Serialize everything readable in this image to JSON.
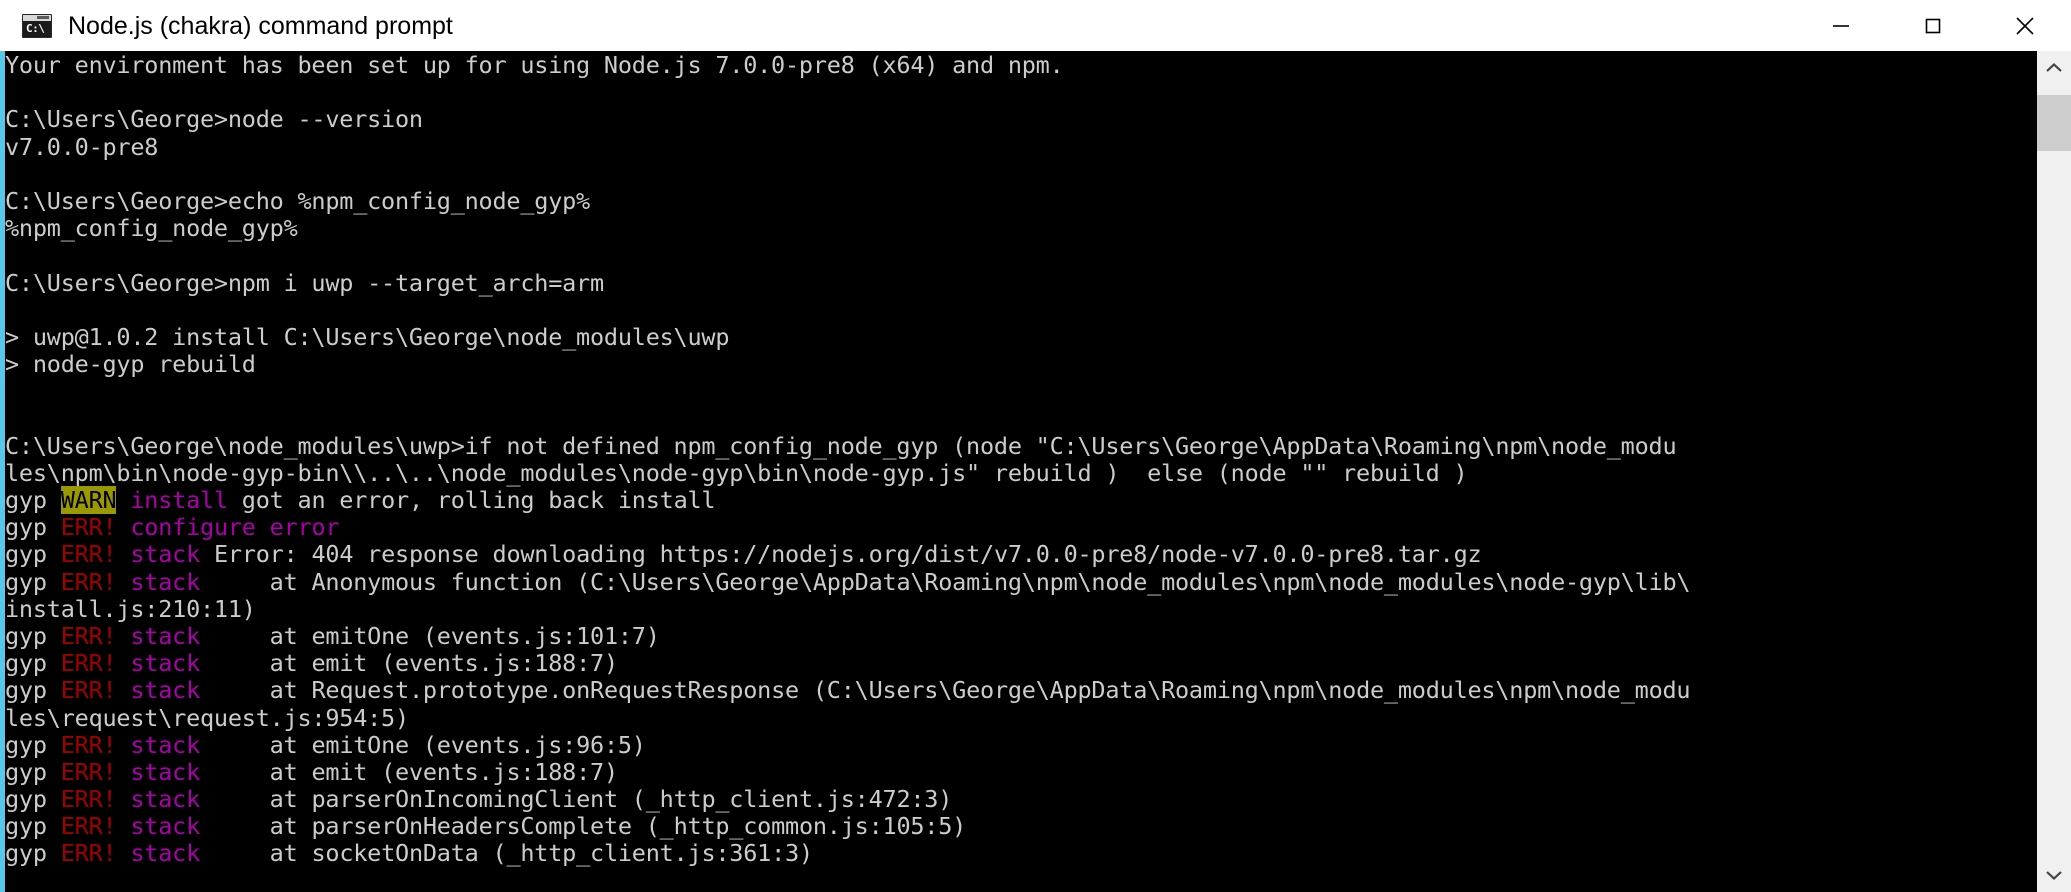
{
  "window": {
    "title": "Node.js (chakra) command prompt",
    "icon": "console-icon",
    "icon_prompt_text": "C:\\",
    "accent_edge_color": "#57c8ec",
    "background_color": "#000000",
    "foreground_color": "#cccccc"
  },
  "window_controls": {
    "minimize_label": "Minimize",
    "maximize_label": "Maximize",
    "close_label": "Close"
  },
  "scrollbar": {
    "up_arrow_label": "Scroll up",
    "down_arrow_label": "Scroll down",
    "thumb_label": "Scroll thumb"
  },
  "console": {
    "lines": [
      [
        {
          "t": "Your environment has been set up for using Node.js 7.0.0-pre8 (x64) and npm.",
          "c": "default"
        }
      ],
      [
        {
          "t": "",
          "c": "default"
        }
      ],
      [
        {
          "t": "C:\\Users\\George>node --version",
          "c": "default"
        }
      ],
      [
        {
          "t": "v7.0.0-pre8",
          "c": "default"
        }
      ],
      [
        {
          "t": "",
          "c": "default"
        }
      ],
      [
        {
          "t": "C:\\Users\\George>echo %npm_config_node_gyp%",
          "c": "default"
        }
      ],
      [
        {
          "t": "%npm_config_node_gyp%",
          "c": "default"
        }
      ],
      [
        {
          "t": "",
          "c": "default"
        }
      ],
      [
        {
          "t": "C:\\Users\\George>npm i uwp --target_arch=arm",
          "c": "default"
        }
      ],
      [
        {
          "t": "",
          "c": "default"
        }
      ],
      [
        {
          "t": "> uwp@1.0.2 install C:\\Users\\George\\node_modules\\uwp",
          "c": "default"
        }
      ],
      [
        {
          "t": "> node-gyp rebuild",
          "c": "default"
        }
      ],
      [
        {
          "t": "",
          "c": "default"
        }
      ],
      [
        {
          "t": "",
          "c": "default"
        }
      ],
      [
        {
          "t": "C:\\Users\\George\\node_modules\\uwp>if not defined npm_config_node_gyp (node \"C:\\Users\\George\\AppData\\Roaming\\npm\\node_modu",
          "c": "default"
        }
      ],
      [
        {
          "t": "les\\npm\\bin\\node-gyp-bin\\\\..\\..\\node_modules\\node-gyp\\bin\\node-gyp.js\" rebuild )  else (node \"\" rebuild )",
          "c": "default"
        }
      ],
      [
        {
          "t": "gyp ",
          "c": "white"
        },
        {
          "t": "WARN",
          "c": "warn"
        },
        {
          "t": " ",
          "c": "white"
        },
        {
          "t": "install",
          "c": "magenta"
        },
        {
          "t": " got an error, rolling back install",
          "c": "white"
        }
      ],
      [
        {
          "t": "gyp ",
          "c": "white"
        },
        {
          "t": "ERR!",
          "c": "red"
        },
        {
          "t": " ",
          "c": "white"
        },
        {
          "t": "configure error",
          "c": "magenta"
        }
      ],
      [
        {
          "t": "gyp ",
          "c": "white"
        },
        {
          "t": "ERR!",
          "c": "red"
        },
        {
          "t": " ",
          "c": "white"
        },
        {
          "t": "stack",
          "c": "magenta"
        },
        {
          "t": " Error: 404 response downloading https://nodejs.org/dist/v7.0.0-pre8/node-v7.0.0-pre8.tar.gz",
          "c": "white"
        }
      ],
      [
        {
          "t": "gyp ",
          "c": "white"
        },
        {
          "t": "ERR!",
          "c": "red"
        },
        {
          "t": " ",
          "c": "white"
        },
        {
          "t": "stack",
          "c": "magenta"
        },
        {
          "t": "     at Anonymous function (C:\\Users\\George\\AppData\\Roaming\\npm\\node_modules\\npm\\node_modules\\node-gyp\\lib\\",
          "c": "white"
        }
      ],
      [
        {
          "t": "install.js:210:11)",
          "c": "white"
        }
      ],
      [
        {
          "t": "gyp ",
          "c": "white"
        },
        {
          "t": "ERR!",
          "c": "red"
        },
        {
          "t": " ",
          "c": "white"
        },
        {
          "t": "stack",
          "c": "magenta"
        },
        {
          "t": "     at emitOne (events.js:101:7)",
          "c": "white"
        }
      ],
      [
        {
          "t": "gyp ",
          "c": "white"
        },
        {
          "t": "ERR!",
          "c": "red"
        },
        {
          "t": " ",
          "c": "white"
        },
        {
          "t": "stack",
          "c": "magenta"
        },
        {
          "t": "     at emit (events.js:188:7)",
          "c": "white"
        }
      ],
      [
        {
          "t": "gyp ",
          "c": "white"
        },
        {
          "t": "ERR!",
          "c": "red"
        },
        {
          "t": " ",
          "c": "white"
        },
        {
          "t": "stack",
          "c": "magenta"
        },
        {
          "t": "     at Request.prototype.onRequestResponse (C:\\Users\\George\\AppData\\Roaming\\npm\\node_modules\\npm\\node_modu",
          "c": "white"
        }
      ],
      [
        {
          "t": "les\\request\\request.js:954:5)",
          "c": "white"
        }
      ],
      [
        {
          "t": "gyp ",
          "c": "white"
        },
        {
          "t": "ERR!",
          "c": "red"
        },
        {
          "t": " ",
          "c": "white"
        },
        {
          "t": "stack",
          "c": "magenta"
        },
        {
          "t": "     at emitOne (events.js:96:5)",
          "c": "white"
        }
      ],
      [
        {
          "t": "gyp ",
          "c": "white"
        },
        {
          "t": "ERR!",
          "c": "red"
        },
        {
          "t": " ",
          "c": "white"
        },
        {
          "t": "stack",
          "c": "magenta"
        },
        {
          "t": "     at emit (events.js:188:7)",
          "c": "white"
        }
      ],
      [
        {
          "t": "gyp ",
          "c": "white"
        },
        {
          "t": "ERR!",
          "c": "red"
        },
        {
          "t": " ",
          "c": "white"
        },
        {
          "t": "stack",
          "c": "magenta"
        },
        {
          "t": "     at parserOnIncomingClient (_http_client.js:472:3)",
          "c": "white"
        }
      ],
      [
        {
          "t": "gyp ",
          "c": "white"
        },
        {
          "t": "ERR!",
          "c": "red"
        },
        {
          "t": " ",
          "c": "white"
        },
        {
          "t": "stack",
          "c": "magenta"
        },
        {
          "t": "     at parserOnHeadersComplete (_http_common.js:105:5)",
          "c": "white"
        }
      ],
      [
        {
          "t": "gyp ",
          "c": "white"
        },
        {
          "t": "ERR!",
          "c": "red"
        },
        {
          "t": " ",
          "c": "white"
        },
        {
          "t": "stack",
          "c": "magenta"
        },
        {
          "t": "     at socketOnData (_http_client.js:361:3)",
          "c": "white"
        }
      ]
    ]
  }
}
